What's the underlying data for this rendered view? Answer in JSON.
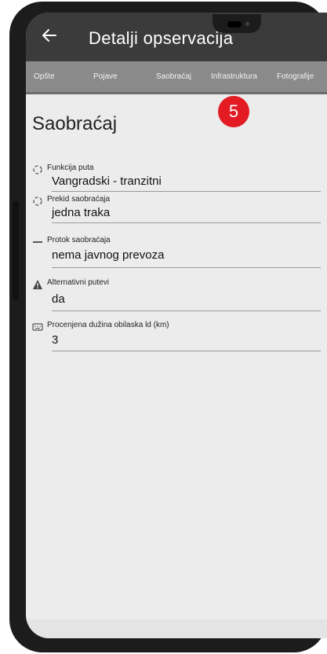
{
  "header": {
    "title": "Detalji opservacija"
  },
  "tabs": [
    {
      "label": "Opšte"
    },
    {
      "label": "Pojave"
    },
    {
      "label": "Saobraćaj"
    },
    {
      "label": "Infrastruktura"
    },
    {
      "label": "Fotografije"
    }
  ],
  "badge": {
    "value": "5",
    "color": "#e31b23"
  },
  "section": {
    "title": "Saobraćaj"
  },
  "fields": [
    {
      "label": "Funkcija puta",
      "value": "Vangradski - tranzitni",
      "icon": "circle-target-icon"
    },
    {
      "label": "Prekid saobraćaja",
      "value": "jedna traka",
      "icon": "circle-target-icon"
    },
    {
      "label": "Protok saobraćaja",
      "value": "nema javnog prevoza",
      "icon": "dash-icon"
    },
    {
      "label": "Alternativni putevi",
      "value": "da",
      "icon": "warning-icon"
    },
    {
      "label": "Procenjena dužina obilaska ld (km)",
      "value": "3",
      "icon": "keyboard-icon"
    }
  ],
  "colors": {
    "app_bar": "#3b3b3b",
    "tab_bar": "#8a8a8a",
    "background": "#ececec"
  }
}
